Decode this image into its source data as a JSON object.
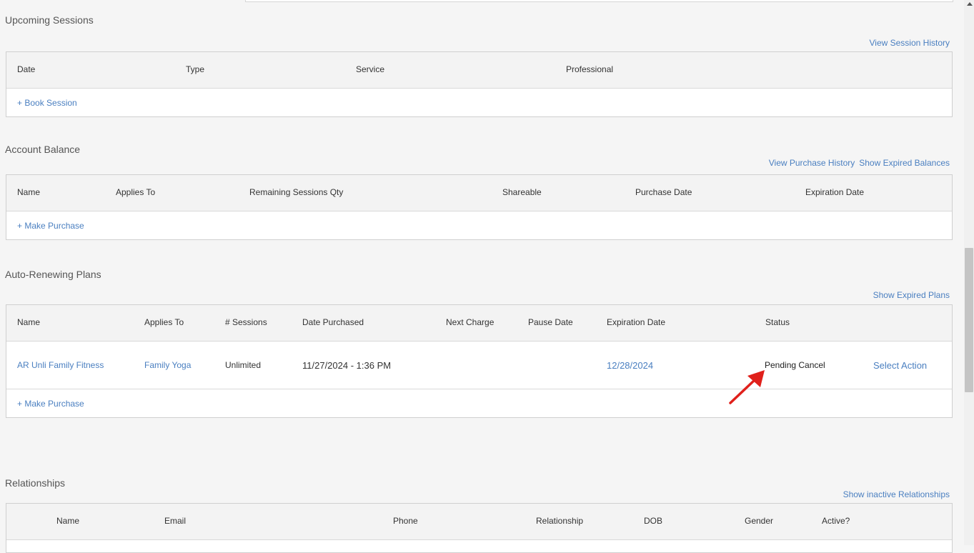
{
  "upcoming": {
    "title": "Upcoming Sessions",
    "history_link": "View Session History",
    "columns": [
      "Date",
      "Type",
      "Service",
      "Professional"
    ],
    "book_link": "+ Book Session"
  },
  "balance": {
    "title": "Account Balance",
    "purchase_history_link": "View Purchase History",
    "expired_link": "Show Expired Balances",
    "columns": [
      "Name",
      "Applies To",
      "Remaining Sessions Qty",
      "Shareable",
      "Purchase Date",
      "Expiration Date"
    ],
    "purchase_link": "+ Make Purchase"
  },
  "plans": {
    "title": "Auto-Renewing Plans",
    "expired_link": "Show Expired Plans",
    "columns": [
      "Name",
      "Applies To",
      "# Sessions",
      "Date Purchased",
      "Next Charge",
      "Pause Date",
      "Expiration Date",
      "Status"
    ],
    "rows": [
      {
        "name": "AR Unli Family Fitness",
        "applies_to": "Family Yoga",
        "sessions": "Unlimited",
        "date_purchased": "11/27/2024 - 1:36 PM",
        "next_charge": "",
        "pause_date": "",
        "expiration_date": "12/28/2024",
        "status": "Pending Cancel",
        "action": "Select Action"
      }
    ],
    "purchase_link": "+ Make Purchase"
  },
  "relationships": {
    "title": "Relationships",
    "inactive_link": "Show inactive Relationships",
    "columns": [
      "Name",
      "Email",
      "Phone",
      "Relationship",
      "DOB",
      "Gender",
      "Active?"
    ]
  },
  "annotation": {
    "color": "#e0201b",
    "icon": "arrow-annotation-icon"
  }
}
